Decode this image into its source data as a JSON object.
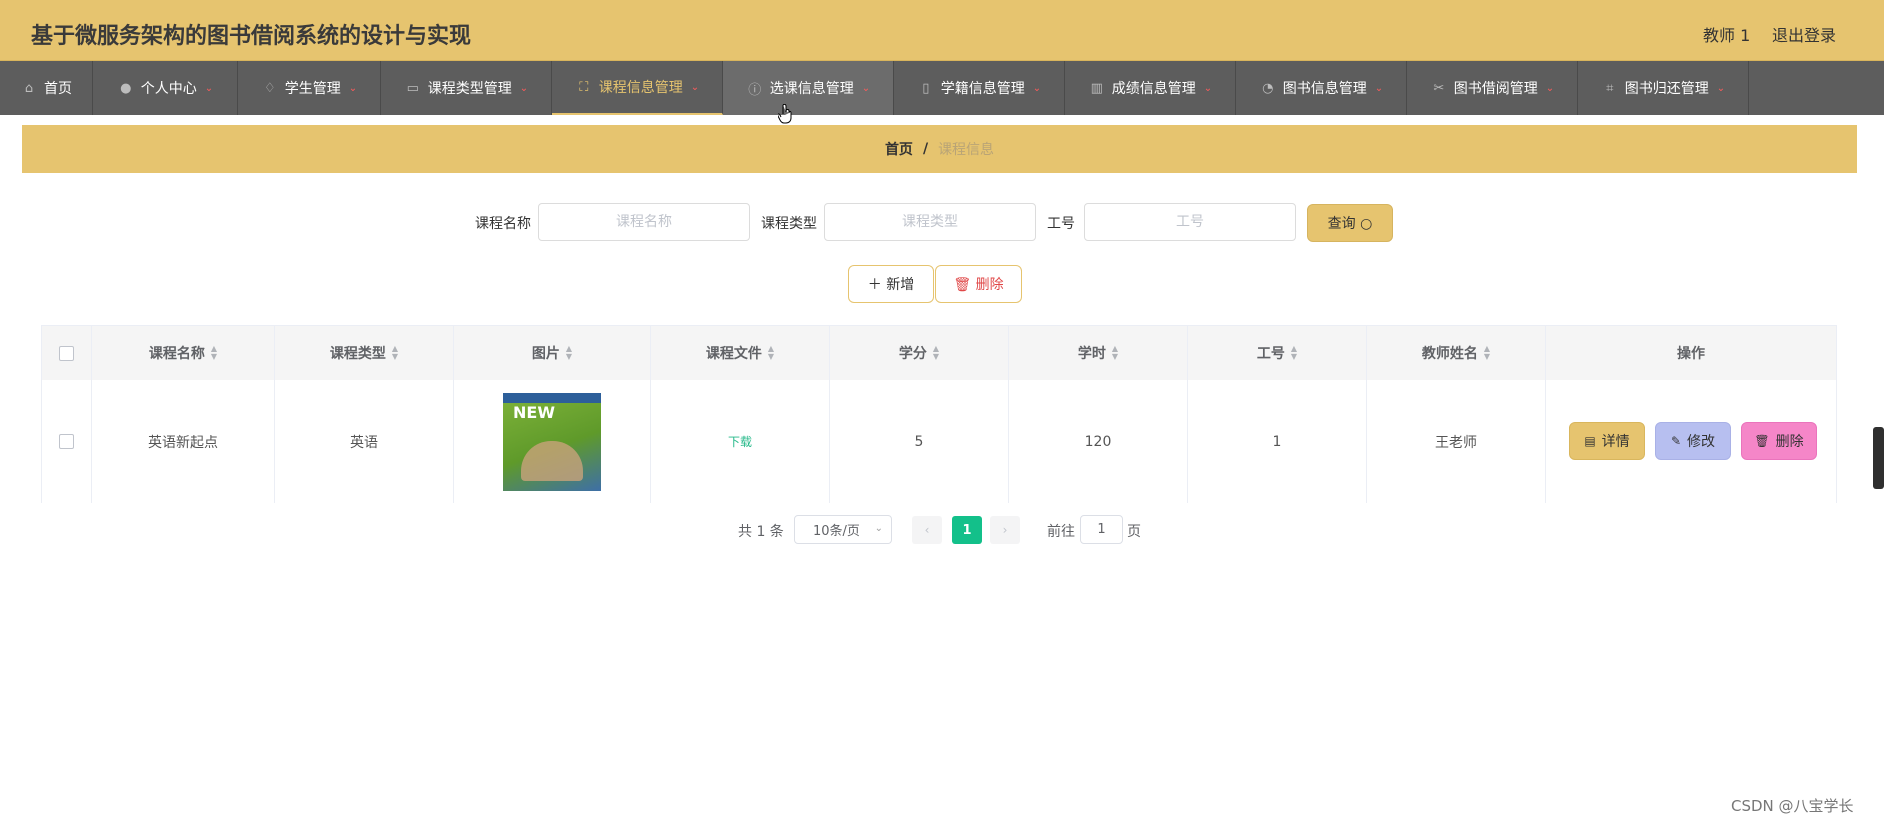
{
  "header": {
    "title": "基于微服务架构的图书借阅系统的设计与实现",
    "user": "教师 1",
    "logout": "退出登录"
  },
  "nav": {
    "items": [
      {
        "label": "首页",
        "icon": "home-icon",
        "glyph": "⌂"
      },
      {
        "label": "个人中心",
        "icon": "user-icon",
        "glyph": "●"
      },
      {
        "label": "学生管理",
        "icon": "bell-off-icon",
        "glyph": "♢"
      },
      {
        "label": "课程类型管理",
        "icon": "id-card-icon",
        "glyph": "▭"
      },
      {
        "label": "课程信息管理",
        "icon": "fullscreen-icon",
        "glyph": "⛶"
      },
      {
        "label": "选课信息管理",
        "icon": "info-icon",
        "glyph": "ⓘ"
      },
      {
        "label": "学籍信息管理",
        "icon": "mobile-icon",
        "glyph": "▯"
      },
      {
        "label": "成绩信息管理",
        "icon": "books-icon",
        "glyph": "▥"
      },
      {
        "label": "图书信息管理",
        "icon": "compass-icon",
        "glyph": "◔"
      },
      {
        "label": "图书借阅管理",
        "icon": "ticket-icon",
        "glyph": "✂"
      },
      {
        "label": "图书归还管理",
        "icon": "crop-icon",
        "glyph": "⌗"
      }
    ],
    "active_index": 4
  },
  "breadcrumb": {
    "home": "首页",
    "separator": "/",
    "current": "课程信息"
  },
  "search": {
    "course_name_label": "课程名称",
    "course_name_placeholder": "课程名称",
    "course_type_label": "课程类型",
    "course_type_placeholder": "课程类型",
    "staff_no_label": "工号",
    "staff_no_placeholder": "工号",
    "query_label": "查询 ○"
  },
  "actions": {
    "add_label": "＋ 新增",
    "delete_label": "🗑 删除"
  },
  "table": {
    "columns": [
      "课程名称",
      "课程类型",
      "图片",
      "课程文件",
      "学分",
      "学时",
      "工号",
      "教师姓名",
      "操作"
    ],
    "rows": [
      {
        "course_name": "英语新起点",
        "course_type": "英语",
        "image_text": "NEW",
        "file_link": "下载",
        "credit": "5",
        "hours": "120",
        "staff_no": "1",
        "teacher": "王老师"
      }
    ],
    "row_actions": {
      "detail": "详情",
      "edit": "修改",
      "delete": "删除"
    }
  },
  "pagination": {
    "total": "共 1 条",
    "page_size": "10条/页",
    "current_page": "1",
    "goto_label": "前往",
    "goto_value": "1",
    "page_suffix": "页"
  },
  "watermark": "CSDN @八宝学长",
  "colors": {
    "accent": "#e6c46f",
    "nav_bg": "#5d5d5d",
    "page_active": "#13c08a",
    "edit_button": "#b7bff0",
    "delete_button": "#f586c8"
  }
}
